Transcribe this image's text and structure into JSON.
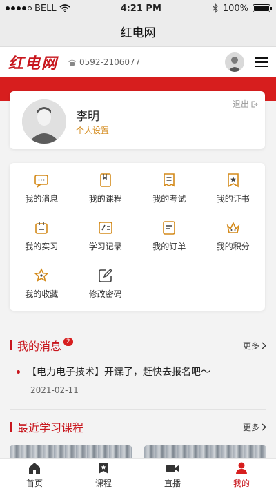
{
  "status_bar": {
    "carrier": "BELL",
    "time": "4:21 PM",
    "battery": "100%",
    "battery_level": 1.0,
    "signal_bars": 4
  },
  "nav": {
    "title": "红电网"
  },
  "header": {
    "logo_text": "红电网",
    "phone": "0592-2106077",
    "avatar_icon": "avatar-icon",
    "menu_icon": "hamburger-icon"
  },
  "profile": {
    "name": "李明",
    "settings_link": "个人设置",
    "logout": "退出"
  },
  "menu": [
    {
      "label": "我的消息",
      "icon": "message-icon"
    },
    {
      "label": "我的课程",
      "icon": "course-icon"
    },
    {
      "label": "我的考试",
      "icon": "exam-icon"
    },
    {
      "label": "我的证书",
      "icon": "certificate-icon"
    },
    {
      "label": "我的实习",
      "icon": "internship-icon"
    },
    {
      "label": "学习记录",
      "icon": "study-record-icon"
    },
    {
      "label": "我的订单",
      "icon": "order-icon"
    },
    {
      "label": "我的积分",
      "icon": "points-icon"
    },
    {
      "label": "我的收藏",
      "icon": "favorite-icon"
    },
    {
      "label": "修改密码",
      "icon": "edit-password-icon"
    }
  ],
  "messages": {
    "title": "我的消息",
    "badge": "2",
    "more": "更多",
    "item": {
      "title": "【电力电子技术】开课了，赶快去报名吧～",
      "date": "2021-02-11"
    }
  },
  "courses": {
    "title": "最近学习课程",
    "more": "更多"
  },
  "tabs": [
    {
      "label": "首页",
      "icon": "home-icon"
    },
    {
      "label": "课程",
      "icon": "course-tab-icon"
    },
    {
      "label": "直播",
      "icon": "live-icon"
    },
    {
      "label": "我的",
      "icon": "profile-icon"
    }
  ],
  "colors": {
    "brand_red": "#c8161d",
    "accent_orange": "#d48a1a",
    "band_red": "#d71e1e"
  }
}
